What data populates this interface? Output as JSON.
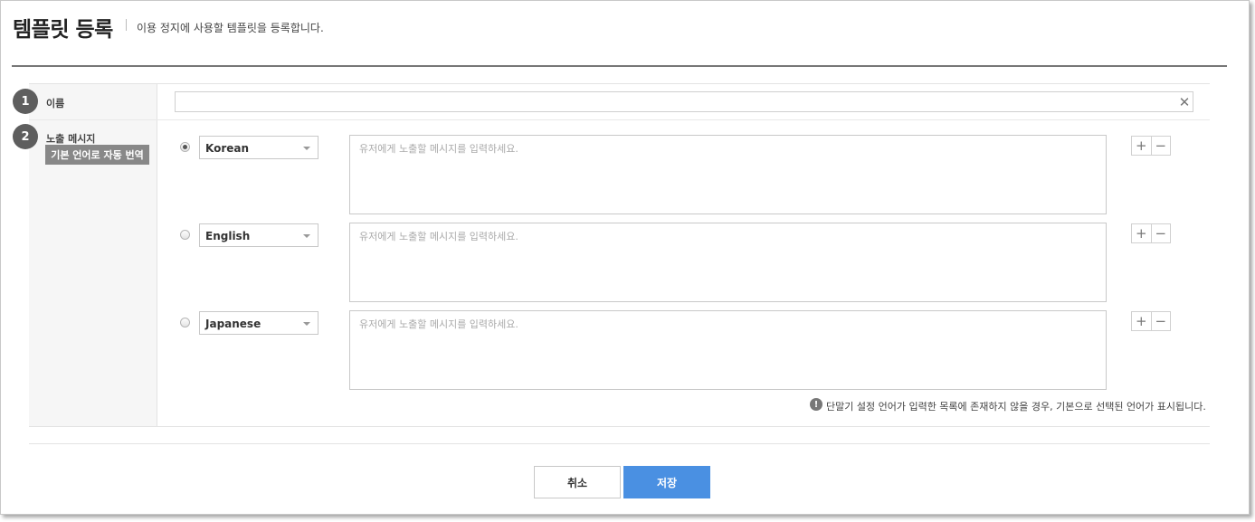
{
  "header": {
    "title": "템플릿 등록",
    "subtitle": "이용 정지에 사용할 템플릿을 등록합니다."
  },
  "fields": {
    "name": {
      "step": "1",
      "label": "이름",
      "value": ""
    },
    "message": {
      "step": "2",
      "label": "노출 메시지",
      "auto_translate_label": "기본 언어로 자동 번역"
    }
  },
  "messages": [
    {
      "language": "Korean",
      "selected": true,
      "placeholder": "유저에게 노출할 메시지를 입력하세요."
    },
    {
      "language": "English",
      "selected": false,
      "placeholder": "유저에게 노출할 메시지를 입력하세요."
    },
    {
      "language": "Japanese",
      "selected": false,
      "placeholder": "유저에게 노출할 메시지를 입력하세요."
    }
  ],
  "controls": {
    "add": "+",
    "remove": "−",
    "clear": "✕",
    "notice_icon": "!"
  },
  "notice": "단말기 설정 언어가 입력한 목록에 존재하지 않을 경우, 기본으로 선택된 언어가 표시됩니다.",
  "buttons": {
    "cancel": "취소",
    "save": "저장"
  },
  "colors": {
    "primary": "#4a90e2",
    "step_badge": "#5e5e5e",
    "auto_translate_bg": "#888888"
  }
}
